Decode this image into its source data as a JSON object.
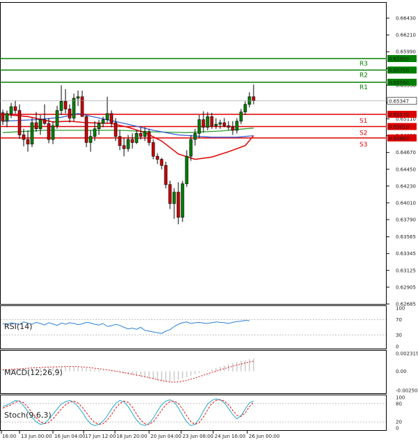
{
  "chart_data": {
    "type": "candlestick",
    "y_ticks": [
      "0.66430",
      "0.66210",
      "0.65990",
      "0.65770",
      "0.65550",
      "0.65330",
      "0.65110",
      "0.64890",
      "0.64670",
      "0.64450",
      "0.64230",
      "0.64010",
      "0.63790",
      "0.63565",
      "0.63345",
      "0.63125",
      "0.62905",
      "0.62685"
    ],
    "x_ticks": [
      "16:00",
      "13 Jun 00:00",
      "16 Jun 04:00",
      "17 Jun 12:00",
      "18 Jun 20:00",
      "20 Jun 04:00",
      "23 Jun 08:00",
      "24 Jun 16:00",
      "26 Jun 00:00"
    ],
    "current_price": "0.65347",
    "levels": [
      {
        "name": "R3",
        "value": 0.659,
        "label": "0.65900",
        "color": "#008000"
      },
      {
        "name": "R2",
        "value": 0.6575,
        "label": "0.65750",
        "color": "#008000"
      },
      {
        "name": "R1",
        "value": 0.6559,
        "label": "0.65590",
        "color": "#008000"
      },
      {
        "name": "S1",
        "value": 0.6517,
        "label": "0.65170",
        "color": "#dd0000"
      },
      {
        "name": "S2",
        "value": 0.6501,
        "label": "0.65010",
        "color": "#dd0000"
      },
      {
        "name": "S3",
        "value": 0.6486,
        "label": "0.64860",
        "color": "#dd0000"
      }
    ],
    "candles": [
      [
        0.6519,
        0.6523,
        0.6503,
        0.6508
      ],
      [
        0.6508,
        0.6522,
        0.65,
        0.6518
      ],
      [
        0.6518,
        0.6532,
        0.6512,
        0.6527
      ],
      [
        0.6527,
        0.6535,
        0.6518,
        0.6522
      ],
      [
        0.6522,
        0.653,
        0.6485,
        0.649
      ],
      [
        0.649,
        0.6498,
        0.6475,
        0.6484
      ],
      [
        0.6484,
        0.6496,
        0.6468,
        0.6478
      ],
      [
        0.6478,
        0.6512,
        0.6474,
        0.6506
      ],
      [
        0.6506,
        0.652,
        0.6494,
        0.6498
      ],
      [
        0.6498,
        0.6516,
        0.649,
        0.651
      ],
      [
        0.651,
        0.653,
        0.6503,
        0.6505
      ],
      [
        0.6505,
        0.6512,
        0.6479,
        0.6484
      ],
      [
        0.6484,
        0.6508,
        0.6478,
        0.6502
      ],
      [
        0.6502,
        0.6528,
        0.6498,
        0.6522
      ],
      [
        0.6522,
        0.6555,
        0.6516,
        0.6534
      ],
      [
        0.6534,
        0.655,
        0.6518,
        0.6524
      ],
      [
        0.6524,
        0.653,
        0.6506,
        0.6512
      ],
      [
        0.6512,
        0.6544,
        0.6508,
        0.6538
      ],
      [
        0.6538,
        0.6548,
        0.6528,
        0.654
      ],
      [
        0.654,
        0.6548,
        0.652,
        0.6514
      ],
      [
        0.6514,
        0.6516,
        0.6474,
        0.648
      ],
      [
        0.648,
        0.6496,
        0.6468,
        0.6488
      ],
      [
        0.6488,
        0.6508,
        0.6482,
        0.6498
      ],
      [
        0.6498,
        0.651,
        0.649,
        0.6505
      ],
      [
        0.6505,
        0.6514,
        0.65,
        0.651
      ],
      [
        0.651,
        0.654,
        0.6506,
        0.6518
      ],
      [
        0.6518,
        0.6522,
        0.65,
        0.6506
      ],
      [
        0.6506,
        0.6512,
        0.6482,
        0.6488
      ],
      [
        0.6488,
        0.6496,
        0.647,
        0.6476
      ],
      [
        0.6476,
        0.6486,
        0.6462,
        0.6472
      ],
      [
        0.6472,
        0.649,
        0.6468,
        0.6484
      ],
      [
        0.6484,
        0.6492,
        0.6472,
        0.648
      ],
      [
        0.648,
        0.6496,
        0.6478,
        0.6492
      ],
      [
        0.6492,
        0.65,
        0.6484,
        0.6488
      ],
      [
        0.6488,
        0.65,
        0.6482,
        0.6494
      ],
      [
        0.6494,
        0.6498,
        0.6476,
        0.648
      ],
      [
        0.648,
        0.6484,
        0.6458,
        0.6462
      ],
      [
        0.6462,
        0.6466,
        0.6452,
        0.6458
      ],
      [
        0.6458,
        0.646,
        0.6445,
        0.645
      ],
      [
        0.645,
        0.6455,
        0.642,
        0.6425
      ],
      [
        0.6425,
        0.643,
        0.6393,
        0.64
      ],
      [
        0.64,
        0.642,
        0.638,
        0.6415
      ],
      [
        0.6415,
        0.6428,
        0.6373,
        0.6382
      ],
      [
        0.6382,
        0.643,
        0.6376,
        0.6426
      ],
      [
        0.6426,
        0.647,
        0.6422,
        0.6462
      ],
      [
        0.6462,
        0.649,
        0.6456,
        0.6484
      ],
      [
        0.6484,
        0.6498,
        0.6476,
        0.6492
      ],
      [
        0.6492,
        0.6516,
        0.6486,
        0.651
      ],
      [
        0.651,
        0.6521,
        0.6493,
        0.65
      ],
      [
        0.65,
        0.652,
        0.6496,
        0.6514
      ],
      [
        0.6514,
        0.6519,
        0.6498,
        0.6502
      ],
      [
        0.6502,
        0.6512,
        0.6498,
        0.6504
      ],
      [
        0.6504,
        0.651,
        0.6498,
        0.6506
      ],
      [
        0.6506,
        0.6512,
        0.65,
        0.6502
      ],
      [
        0.6502,
        0.6508,
        0.6496,
        0.65
      ],
      [
        0.65,
        0.6508,
        0.649,
        0.6496
      ],
      [
        0.6496,
        0.6512,
        0.6492,
        0.6508
      ],
      [
        0.6508,
        0.6524,
        0.6504,
        0.652
      ],
      [
        0.652,
        0.6534,
        0.6516,
        0.653
      ],
      [
        0.653,
        0.6546,
        0.6526,
        0.654
      ],
      [
        0.654,
        0.6556,
        0.653,
        0.6535
      ]
    ],
    "ma_blue": [
      [
        0,
        0.6508
      ],
      [
        8,
        0.651
      ],
      [
        14,
        0.6513
      ],
      [
        18,
        0.6518
      ],
      [
        24,
        0.6511
      ],
      [
        30,
        0.6504
      ],
      [
        36,
        0.6496
      ],
      [
        42,
        0.649
      ],
      [
        50,
        0.6487
      ],
      [
        56,
        0.6487
      ],
      [
        60,
        0.6489
      ]
    ],
    "ma_green": [
      [
        0,
        0.6493
      ],
      [
        10,
        0.6496
      ],
      [
        20,
        0.6496
      ],
      [
        28,
        0.6496
      ],
      [
        36,
        0.6494
      ],
      [
        44,
        0.6493
      ],
      [
        52,
        0.6495
      ],
      [
        58,
        0.6498
      ],
      [
        60,
        0.6499
      ]
    ],
    "ma_red": [
      [
        0,
        0.6517
      ],
      [
        6,
        0.6514
      ],
      [
        12,
        0.6507
      ],
      [
        16,
        0.6508
      ],
      [
        20,
        0.6506
      ],
      [
        26,
        0.6505
      ],
      [
        30,
        0.65
      ],
      [
        34,
        0.6493
      ],
      [
        38,
        0.6482
      ],
      [
        42,
        0.6465
      ],
      [
        46,
        0.6458
      ],
      [
        50,
        0.6461
      ],
      [
        54,
        0.6468
      ],
      [
        58,
        0.6476
      ],
      [
        60,
        0.6489
      ]
    ],
    "rsi": {
      "label": "RSI(14)",
      "ticks": [
        "100",
        "70",
        "30",
        "0"
      ],
      "levels": [
        70,
        30
      ],
      "values": [
        60,
        56,
        62,
        60,
        57,
        64,
        61,
        58,
        63,
        60,
        56,
        62,
        59,
        55,
        61,
        58,
        62,
        60,
        57,
        59,
        63,
        61,
        58,
        56,
        60,
        52,
        54,
        58,
        55,
        50,
        46,
        48,
        45,
        50,
        42,
        40,
        38,
        36,
        34,
        40,
        44,
        52,
        58,
        62,
        64,
        60,
        62,
        63,
        61,
        60,
        62,
        64,
        63,
        62,
        60,
        63,
        65,
        66,
        68,
        67
      ]
    },
    "macd": {
      "label": "MACD(12;26,9)",
      "ticks": [
        "0.002319",
        "0.00",
        "-0.002504"
      ],
      "hist": [
        0.00016,
        0.00019,
        0.00022,
        0.00026,
        0.0003,
        0.00033,
        0.00036,
        0.0004,
        0.00042,
        0.00044,
        0.00046,
        0.00048,
        0.0005,
        0.00052,
        0.00055,
        0.00058,
        0.0006,
        0.00056,
        0.00052,
        0.00046,
        0.0004,
        0.00034,
        0.00028,
        0.0002,
        0.00012,
        4e-05,
        -4e-05,
        -0.00012,
        -0.0002,
        -0.0003,
        -0.0004,
        -0.0005,
        -0.0006,
        -0.0007,
        -0.00082,
        -0.00094,
        -0.00108,
        -0.0012,
        -0.00132,
        -0.00142,
        -0.00134,
        -0.00124,
        -0.0011,
        -0.00094,
        -0.00076,
        -0.00058,
        -0.0004,
        -0.00022,
        -6e-05,
        0.0001,
        0.00026,
        0.00042,
        0.00058,
        0.00074,
        0.0009,
        0.00106,
        0.0012,
        0.00132,
        0.00146,
        0.00158,
        0.00168
      ],
      "signal": [
        0.0002,
        0.00022,
        0.00025,
        0.00028,
        0.00032,
        0.00036,
        0.0004,
        0.00043,
        0.00046,
        0.00049,
        0.00052,
        0.00054,
        0.00056,
        0.00058,
        0.0006,
        0.00062,
        0.00063,
        0.00062,
        0.0006,
        0.00056,
        0.00052,
        0.00046,
        0.0004,
        0.00033,
        0.00026,
        0.00018,
        0.0001,
        2e-05,
        -8e-05,
        -0.00018,
        -0.00028,
        -0.00038,
        -0.0005,
        -0.0006,
        -0.00072,
        -0.00084,
        -0.00096,
        -0.0011,
        -0.00122,
        -0.00132,
        -0.0014,
        -0.00142,
        -0.00138,
        -0.0013,
        -0.00118,
        -0.00104,
        -0.00088,
        -0.0007,
        -0.00052,
        -0.00034,
        -0.00016,
        0.0,
        0.00018,
        0.00034,
        0.0005,
        0.00066,
        0.0008,
        0.00094,
        0.00108,
        0.0012,
        0.00132
      ]
    },
    "stoch": {
      "label": "Stoch(9,6,3)",
      "ticks": [
        "100",
        "80",
        "20",
        "0"
      ],
      "k": [
        70,
        75,
        82,
        90,
        88,
        72,
        55,
        35,
        20,
        12,
        15,
        28,
        45,
        62,
        78,
        86,
        90,
        84,
        70,
        52,
        30,
        14,
        8,
        12,
        22,
        40,
        62,
        80,
        90,
        86,
        70,
        48,
        26,
        12,
        8,
        15,
        32,
        55,
        76,
        88,
        92,
        85,
        66,
        42,
        20,
        8,
        12,
        30,
        56,
        78,
        90,
        95,
        92,
        82,
        64,
        44,
        30,
        40,
        62,
        82,
        88
      ],
      "d": [
        65,
        70,
        76,
        84,
        88,
        82,
        68,
        50,
        34,
        20,
        15,
        18,
        30,
        46,
        62,
        76,
        85,
        88,
        82,
        68,
        50,
        32,
        18,
        12,
        14,
        26,
        44,
        64,
        80,
        88,
        84,
        68,
        46,
        26,
        14,
        12,
        20,
        38,
        58,
        76,
        86,
        88,
        80,
        62,
        40,
        20,
        12,
        18,
        36,
        60,
        80,
        90,
        92,
        88,
        76,
        58,
        42,
        38,
        50,
        70,
        84
      ]
    }
  }
}
